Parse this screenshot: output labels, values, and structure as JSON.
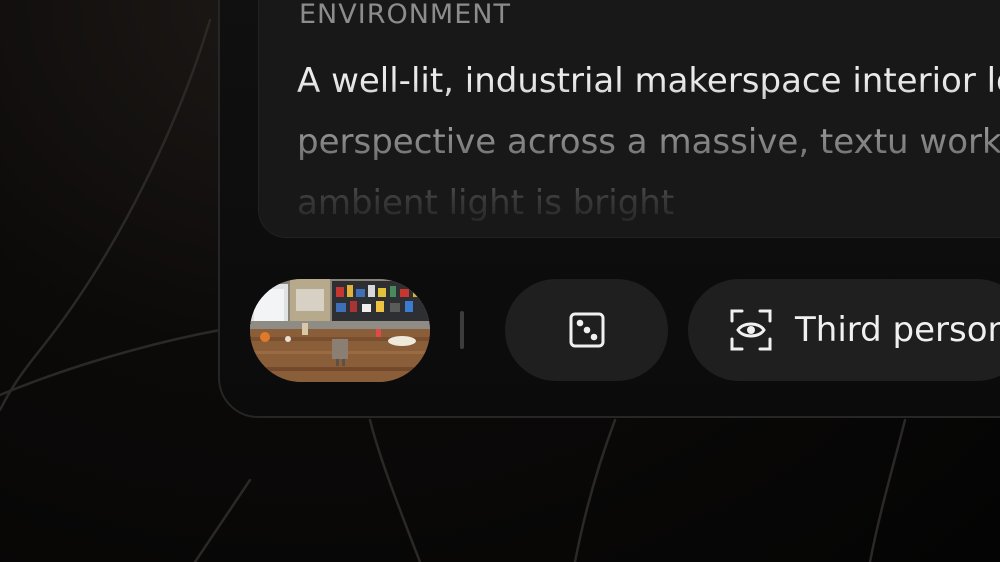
{
  "environment": {
    "label": "ENVIRONMENT",
    "description": "A well-lit, industrial makerspace interior low perspective across a massive, textu workbench. The ambient light is bright"
  },
  "toolbar": {
    "thumbnail_alt": "makerspace workbench preview",
    "randomize_icon": "dice-icon",
    "camera_icon": "eye-focus-icon",
    "camera_label": "Third person"
  },
  "colors": {
    "background": "#050505",
    "panel": "#0b0b0b",
    "card": "#181818",
    "button": "#1f1f1f",
    "text_primary": "#ebebeb",
    "text_label": "#8c8c8c"
  }
}
